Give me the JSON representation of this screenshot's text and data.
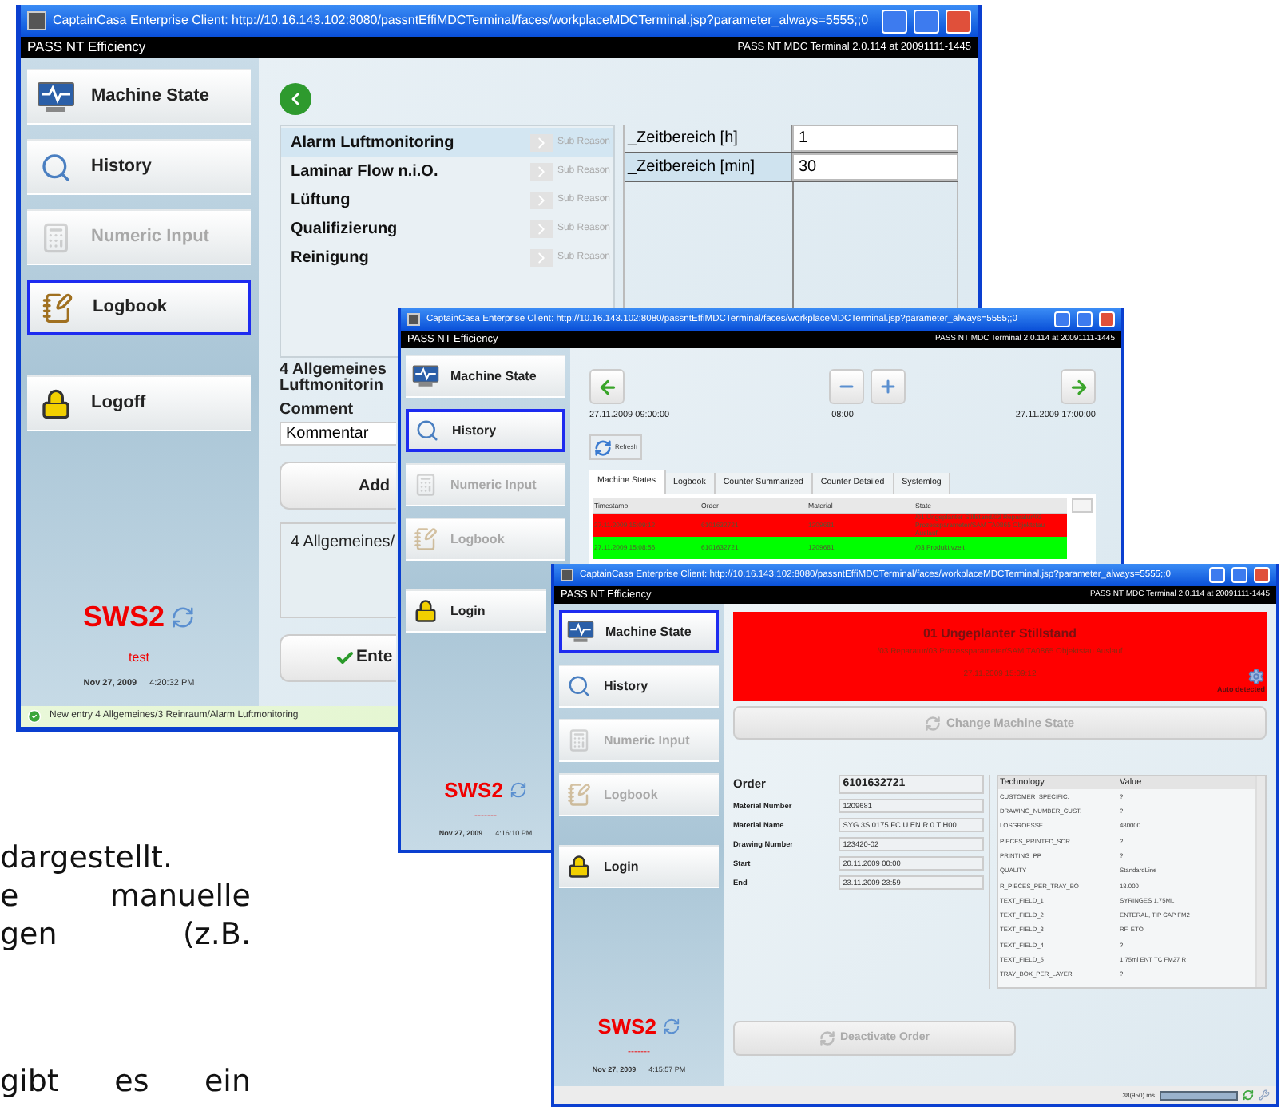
{
  "document_text": [
    "dargestellt.",
    "e manuelle",
    "gen (z.B.",
    "gibt es ein"
  ],
  "windows": [
    {
      "kind": "logbook",
      "title": "CaptainCasa Enterprise Client: http://10.16.143.102:8080/passntEffiMDCTerminal/faces/workplaceMDCTerminal.jsp?parameter_always=5555;;0",
      "app_name": "PASS NT Efficiency",
      "version": "PASS NT MDC Terminal 2.0.114 at 20091111-1445",
      "nav": [
        {
          "label": "Machine State",
          "selected": false,
          "disabled": false
        },
        {
          "label": "History",
          "selected": false,
          "disabled": false
        },
        {
          "label": "Numeric Input",
          "selected": false,
          "disabled": true
        },
        {
          "label": "Logbook",
          "selected": true,
          "disabled": false
        },
        {
          "label": "Logoff",
          "selected": false,
          "disabled": false
        }
      ],
      "logo": "SWS2",
      "user": "test",
      "date": "Nov 27, 2009",
      "time": "4:20:32 PM",
      "reasons": [
        {
          "label": "Alarm Luftmonitoring",
          "action": "Sub Reason",
          "selected": true
        },
        {
          "label": "Laminar Flow n.i.O.",
          "action": "Sub Reason",
          "selected": false
        },
        {
          "label": "Lüftung",
          "action": "Sub Reason",
          "selected": false
        },
        {
          "label": "Qualifizierung",
          "action": "Sub Reason",
          "selected": false
        },
        {
          "label": "Reinigung",
          "action": "Sub Reason",
          "selected": false
        }
      ],
      "parameters": [
        {
          "label": "_Zeitbereich [h]",
          "value": "1",
          "selected": false
        },
        {
          "label": "_Zeitbereich [min]",
          "value": "30",
          "selected": true
        }
      ],
      "selection_path": [
        "4 Allgemeines",
        "Luftmonitorin"
      ],
      "comment_label": "Comment",
      "comment_value": "Kommentar",
      "add_button": "Add",
      "entries": "4 Allgemeines/",
      "enter_button": "Ente",
      "status_bar": "New entry 4 Allgemeines/3 Reinraum/Alarm Luftmonitoring"
    },
    {
      "kind": "history",
      "title": "CaptainCasa Enterprise Client: http://10.16.143.102:8080/passntEffiMDCTerminal/faces/workplaceMDCTerminal.jsp?parameter_always=5555;;0",
      "app_name": "PASS NT Efficiency",
      "version": "PASS NT MDC Terminal 2.0.114 at 20091111-1445",
      "nav": [
        {
          "label": "Machine State",
          "selected": false,
          "disabled": false
        },
        {
          "label": "History",
          "selected": true,
          "disabled": false
        },
        {
          "label": "Numeric Input",
          "selected": false,
          "disabled": true
        },
        {
          "label": "Logbook",
          "selected": false,
          "disabled": true
        },
        {
          "label": "Login",
          "selected": false,
          "disabled": false
        }
      ],
      "logo": "SWS2",
      "user": "-------",
      "date": "Nov 27, 2009",
      "time": "4:16:10 PM",
      "times": [
        "27.11.2009 09:00:00",
        "08:00",
        "27.11.2009 17:00:00"
      ],
      "refresh": "Refresh",
      "tabs": [
        {
          "label": "Machine States",
          "selected": true
        },
        {
          "label": "Logbook",
          "selected": false
        },
        {
          "label": "Counter Summarized",
          "selected": false
        },
        {
          "label": "Counter Detailed",
          "selected": false
        },
        {
          "label": "Systemlog",
          "selected": false
        }
      ],
      "columns": [
        "Timestamp",
        "Order",
        "Material",
        "State"
      ],
      "rows": [
        {
          "cells": [
            "27.11.2009 15:09:12",
            "6101632721",
            "1209681",
            "/01 Ungeplanter Stillstand/03 Reparatur/03 Prozessparameter/SAM TA0865 Objektstau Auslauf"
          ],
          "color": "#ff0000"
        },
        {
          "cells": [
            "27.11.2009 15:08:56",
            "6101632721",
            "1209681",
            "/03 Produktivzeit"
          ],
          "color": "#00ff00"
        }
      ],
      "scroll_button": "..."
    },
    {
      "kind": "machine_state",
      "title": "CaptainCasa Enterprise Client: http://10.16.143.102:8080/passntEffiMDCTerminal/faces/workplaceMDCTerminal.jsp?parameter_always=5555;;0",
      "app_name": "PASS NT Efficiency",
      "version": "PASS NT MDC Terminal 2.0.114 at 20091111-1445",
      "nav": [
        {
          "label": "Machine State",
          "selected": true,
          "disabled": false
        },
        {
          "label": "History",
          "selected": false,
          "disabled": false
        },
        {
          "label": "Numeric Input",
          "selected": false,
          "disabled": true
        },
        {
          "label": "Logbook",
          "selected": false,
          "disabled": true
        },
        {
          "label": "Login",
          "selected": false,
          "disabled": false
        }
      ],
      "logo": "SWS2",
      "user": "-------",
      "date": "Nov 27, 2009",
      "time": "4:15:57 PM",
      "banner": {
        "title": "01 Ungeplanter Stillstand",
        "path": "/03 Reparatur/03 Prozessparameter/SAM TA0865 Objektstau Auslauf",
        "time": "27.11.2009 15:09:12",
        "note": "Auto detected",
        "color": "#ff0000"
      },
      "change_button": "Change Machine State",
      "order": [
        {
          "label": "Order",
          "value": "6101632721"
        },
        {
          "label": "Material Number",
          "value": "1209681"
        },
        {
          "label": "Material Name",
          "value": "SYG 3S 0175 FC U EN R 0 T H00"
        },
        {
          "label": "Drawing Number",
          "value": "123420-02"
        },
        {
          "label": "Start",
          "value": "20.11.2009 00:00"
        },
        {
          "label": "End",
          "value": "23.11.2009 23:59"
        }
      ],
      "technology": {
        "columns": [
          "Technology",
          "Value"
        ],
        "rows": [
          [
            "CUSTOMER_SPECIFIC.",
            "?"
          ],
          [
            "DRAWING_NUMBER_CUST.",
            "?"
          ],
          [
            "LOSGROESSE",
            "480000"
          ],
          [
            "PIECES_PRINTED_SCR",
            "?"
          ],
          [
            "PRINTING_PP",
            "?"
          ],
          [
            "QUALITY",
            "StandardLine"
          ],
          [
            "R_PIECES_PER_TRAY_BO",
            "18.000"
          ],
          [
            "TEXT_FIELD_1",
            "SYRINGES 1.75ML"
          ],
          [
            "TEXT_FIELD_2",
            "ENTERAL, TIP CAP FM2"
          ],
          [
            "TEXT_FIELD_3",
            "RF, ETO"
          ],
          [
            "TEXT_FIELD_4",
            "?"
          ],
          [
            "TEXT_FIELD_5",
            "1.75ml ENT TC FM27 R"
          ],
          [
            "TRAY_BOX_PER_LAYER",
            "?"
          ]
        ]
      },
      "deactivate_button": "Deactivate Order",
      "status": "38(950) ms",
      "progress": {
        "level": 1
      }
    }
  ]
}
